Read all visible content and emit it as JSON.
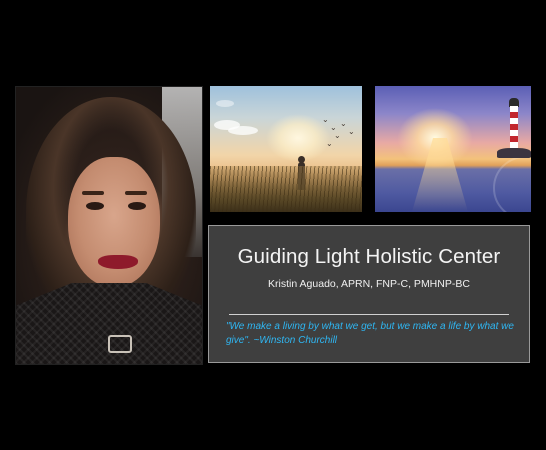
{
  "panel": {
    "title": "Guiding Light Holistic Center",
    "subtitle": "Kristin Aguado, APRN, FNP-C, PMHNP-BC",
    "quote": "\"We make a living by what we get, but we make a life by what we give\". ~Winston Churchill"
  },
  "colors": {
    "background": "#000000",
    "panel_fill": "#3f3f3f",
    "quote_text": "#2fb6f2",
    "title_text": "#f4f4f4"
  },
  "photos": [
    {
      "id": "portrait",
      "subject": "portrait-of-woman"
    },
    {
      "id": "meadow",
      "subject": "person-in-sunlit-field-with-birds"
    },
    {
      "id": "lighthouse",
      "subject": "lighthouse-at-sunset-over-sea"
    }
  ]
}
